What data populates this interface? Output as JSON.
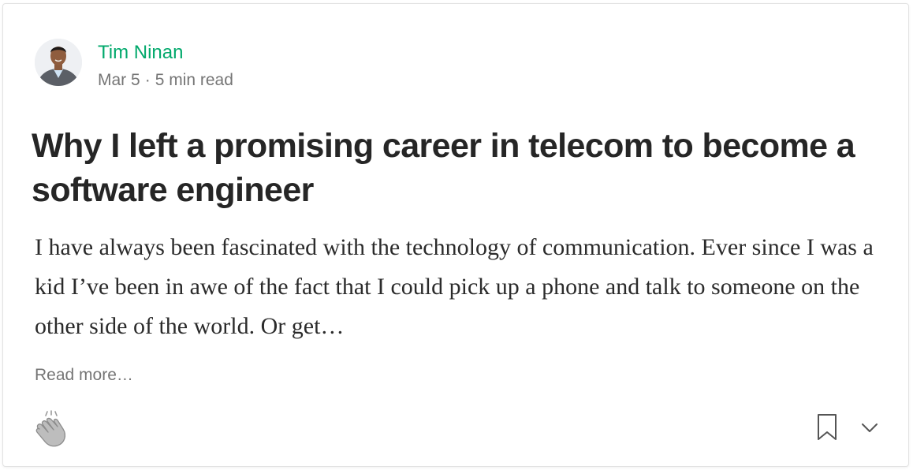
{
  "author": {
    "name": "Tim Ninan",
    "avatar_icon": "author-avatar",
    "date": "Mar 5",
    "separator": "·",
    "read_time": "5 min read"
  },
  "post": {
    "title": "Why I left a promising career in telecom to become a software engineer",
    "excerpt": "I have always been fascinated with the technology of communication. Ever since I was a kid I’ve been in awe of the fact that I could pick up a phone and talk to someone on the other side of the world. Or get…",
    "read_more": "Read more…"
  },
  "actions": {
    "clap_icon": "clap-icon",
    "bookmark_icon": "bookmark-icon",
    "more_icon": "chevron-down-icon"
  },
  "colors": {
    "author_name": "#02a96c",
    "title": "#262626",
    "body": "#2b2b2b",
    "muted": "#757575",
    "border": "#e2e2e2"
  }
}
